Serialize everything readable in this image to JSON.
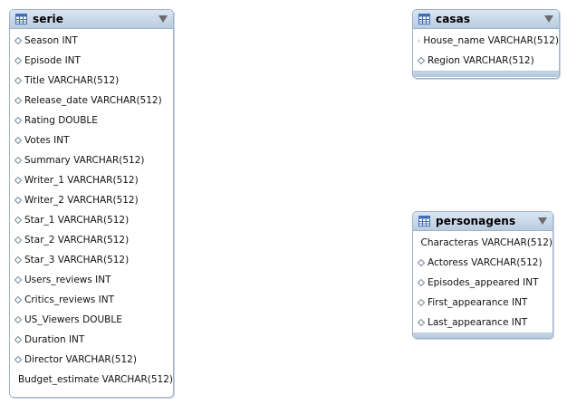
{
  "tables": {
    "serie": {
      "title": "serie",
      "columns": [
        "Season INT",
        "Episode INT",
        "Title VARCHAR(512)",
        "Release_date VARCHAR(512)",
        "Rating DOUBLE",
        "Votes INT",
        "Summary VARCHAR(512)",
        "Writer_1 VARCHAR(512)",
        "Writer_2 VARCHAR(512)",
        "Star_1 VARCHAR(512)",
        "Star_2 VARCHAR(512)",
        "Star_3 VARCHAR(512)",
        "Users_reviews INT",
        "Critics_reviews INT",
        "US_Viewers DOUBLE",
        "Duration INT",
        "Director VARCHAR(512)",
        "Budget_estimate VARCHAR(512)"
      ]
    },
    "casas": {
      "title": "casas",
      "columns": [
        "House_name VARCHAR(512)",
        "Region VARCHAR(512)"
      ]
    },
    "personagens": {
      "title": "personagens",
      "columns": [
        "Characteras VARCHAR(512)",
        "Actoress VARCHAR(512)",
        "Episodes_appeared INT",
        "First_appearance INT",
        "Last_appearance INT"
      ]
    }
  },
  "colors": {
    "header_top": "#dbe6f2",
    "header_bottom": "#b9cce0",
    "border": "#9eb3c9",
    "icon_blue": "#3f6fb5"
  },
  "icons": {
    "table": "table-grid-icon",
    "collapse": "triangle-down-icon",
    "column": "diamond-icon"
  }
}
